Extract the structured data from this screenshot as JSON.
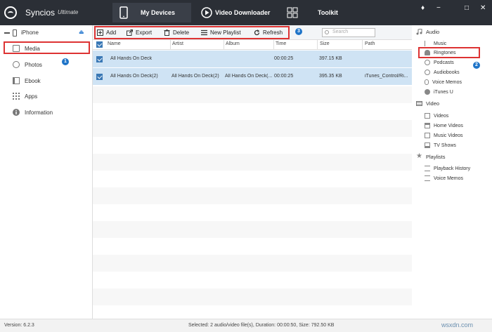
{
  "app": {
    "name": "Syncios",
    "edition": "Ultimate"
  },
  "nav": {
    "my_devices": "My Devices",
    "video_downloader": "Video Downloader",
    "toolkit": "Toolkit"
  },
  "window_controls": [
    "♦",
    "−",
    "□",
    "✕"
  ],
  "device": {
    "name": "iPhone"
  },
  "sidebar": {
    "items": [
      {
        "label": "Media"
      },
      {
        "label": "Photos"
      },
      {
        "label": "Ebook"
      },
      {
        "label": "Apps"
      },
      {
        "label": "Information"
      }
    ]
  },
  "toolbar": {
    "add": "Add",
    "export": "Export",
    "delete": "Delete",
    "new_playlist": "New Playlist",
    "refresh": "Refresh"
  },
  "search": {
    "placeholder": "Search"
  },
  "table": {
    "headers": [
      "Name",
      "Artist",
      "Album",
      "Time",
      "Size",
      "Path"
    ],
    "rows": [
      {
        "name": "All Hands On Deck",
        "artist": "",
        "album": "",
        "time": "00:00:25",
        "size": "397.15 KB",
        "path": ""
      },
      {
        "name": "All Hands On Deck(2)",
        "artist": "All Hands On Deck(2)",
        "album": "All Hands On Deck(...",
        "time": "00:00:25",
        "size": "395.35 KB",
        "path": "iTunes_Control/Ri..."
      }
    ]
  },
  "right_panel": {
    "audio": {
      "title": "Audio",
      "items": [
        "Music",
        "Ringtones",
        "Podcasts",
        "Audiobooks",
        "Voice Memos",
        "iTunes U"
      ]
    },
    "video": {
      "title": "Video",
      "items": [
        "Videos",
        "Home Videos",
        "Music Videos",
        "TV Shows"
      ]
    },
    "playlists": {
      "title": "Playlists",
      "items": [
        "Playback History",
        "Voice Memos"
      ]
    }
  },
  "status": {
    "version": "Version: 6.2.3",
    "summary": "Selected: 2 audio/video file(s), Duration: 00:00:50, Size: 792.50 KB"
  },
  "annotations": {
    "badge1": "1",
    "badge2": "2",
    "badge3": "3"
  },
  "watermark": "wsxdn.com",
  "colors": {
    "titlebar": "#2b2f36",
    "selected_row": "#cfe3f4",
    "accent": "#1e74c8",
    "highlight": "#d33333"
  }
}
